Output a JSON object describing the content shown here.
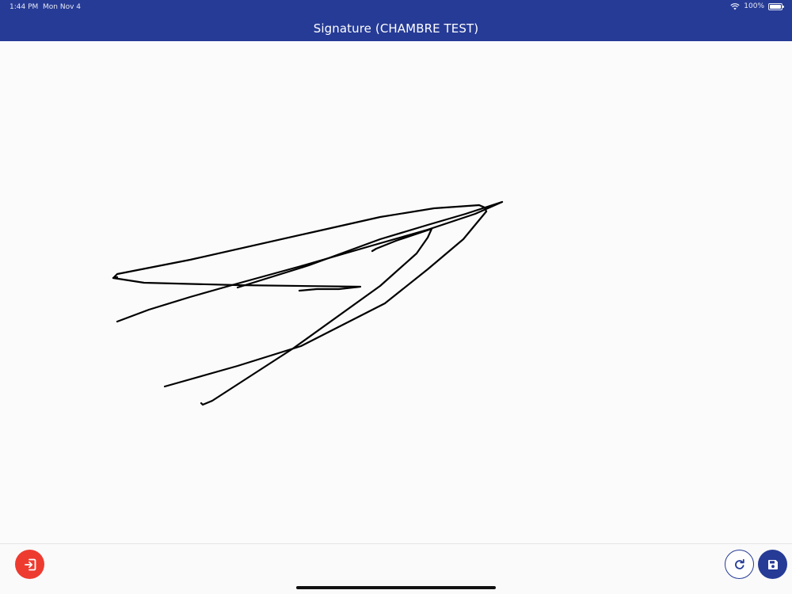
{
  "status_bar": {
    "time": "1:44 PM",
    "date": "Mon Nov 4",
    "battery": "100%",
    "icons": [
      "wifi-icon",
      "battery-icon"
    ]
  },
  "header": {
    "title": "Signature (CHAMBRE TEST)"
  },
  "footer": {
    "buttons": [
      {
        "name": "exit",
        "icon": "sign-in-icon",
        "color": "#ee3b30"
      },
      {
        "name": "refresh",
        "icon": "refresh-icon",
        "color": "#263b96"
      },
      {
        "name": "save",
        "icon": "floppy-disk-icon",
        "color": "#263b96"
      }
    ]
  },
  "colors": {
    "header": "#263b96",
    "accent": "#263b96",
    "danger": "#ee3b30",
    "ink": "#000000",
    "canvas": "#fbfbfc"
  }
}
